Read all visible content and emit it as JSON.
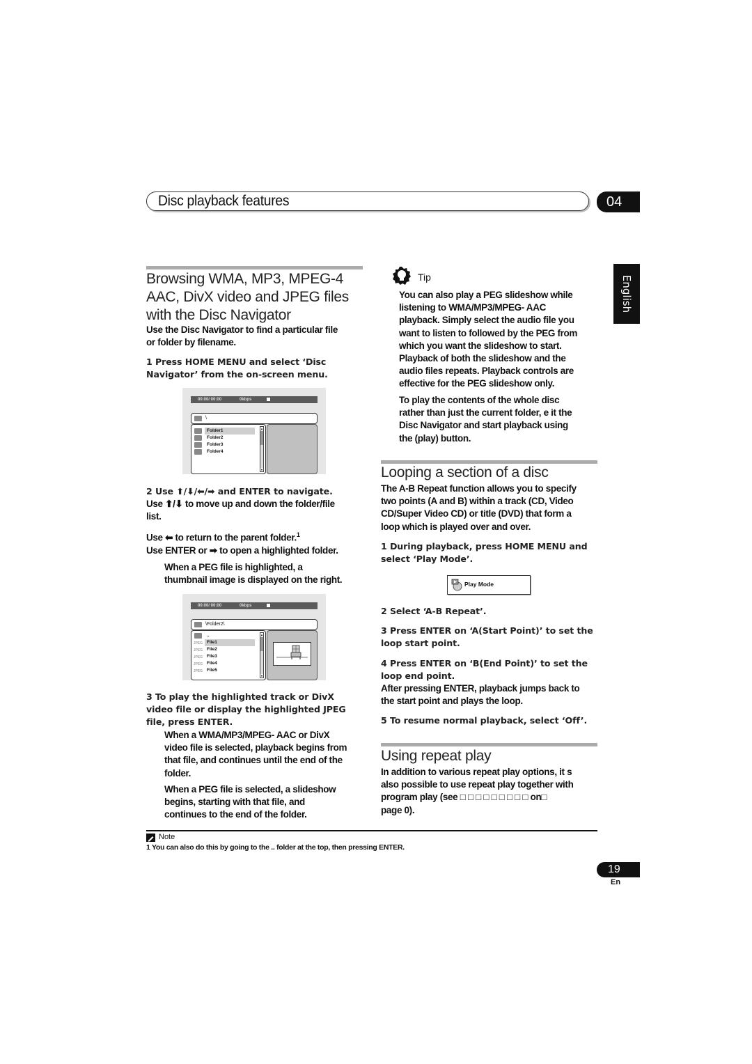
{
  "header": {
    "title": "Disc playback features",
    "chapter": "04"
  },
  "language_tab": "English",
  "left": {
    "section_title_lines": [
      "Browsing WMA, MP3, MPEG-4",
      "AAC, DivX video and JPEG files",
      "with the Disc Navigator"
    ],
    "intro": [
      "Use the Disc Navigator to find a particular file",
      "or folder by filename."
    ],
    "step1": [
      "1    Press HOME MENU and select ‘Disc",
      "Navigator’ from the on-screen menu."
    ],
    "screen1": {
      "status": {
        "time": "00:00/ 00:00",
        "bitrate": "0kbps"
      },
      "path": "\\",
      "items": [
        "Folder1",
        "Folder2",
        "Folder3",
        "Folder4"
      ]
    },
    "step2": [
      "2    Use ⬆/⬇/⬅/➡ and ENTER to navigate."
    ],
    "step2_body": [
      "Use ⬆/⬇ to move up and down the folder/file",
      "list."
    ],
    "para_return": "Use ⬅ to return to the parent folder.",
    "para_return_footnote": "1",
    "para_enter": "Use ENTER or ➡ to open a highlighted folder.",
    "para_jpeg": [
      "When a   PEG file is highlighted, a",
      "thumbnail image is displayed on the right."
    ],
    "screen2": {
      "status": {
        "time": "00:00/ 00:00",
        "bitrate": "0kbps"
      },
      "path": "\\Folder2\\",
      "parent": "..",
      "items": [
        "File1",
        "File2",
        "File3",
        "File4",
        "File5"
      ],
      "file_type_label": "JPEG"
    },
    "step3": [
      "3    To play the highlighted track or DivX",
      "video file or display the highlighted JPEG",
      "file, press ENTER."
    ],
    "step3_body1": [
      "When a WMA/MP3/MPEG-   AAC or DivX",
      "video file is selected, playback begins from",
      "that file, and continues until the end of the",
      "folder."
    ],
    "step3_body2": [
      "When a   PEG file is selected, a slideshow",
      "begins, starting with that file, and",
      "continues to the end of the folder."
    ]
  },
  "right": {
    "tip_label": "Tip",
    "tip1": [
      "You can also play a   PEG slideshow while",
      "listening to WMA/MP3/MPEG-   AAC",
      "playback. Simply select the audio file you",
      "want to listen to followed by the   PEG from",
      "which you want the slideshow to start.",
      "Playback of both the slideshow and the",
      "audio files repeats. Playback controls are",
      "effective for the   PEG slideshow only."
    ],
    "tip2": [
      "To play the contents of the whole disc",
      "rather than just the current folder, e  it the",
      "Disc Navigator and start playback using",
      "the      (play) button."
    ],
    "loop_title": "Looping a section of a disc",
    "loop_intro": [
      "The A-B Repeat function allows you to specify",
      "two points (A and B) within a track (CD, Video",
      "CD/Super Video CD) or title (DVD) that form a",
      "loop which is played over and over."
    ],
    "loop_step1": [
      "1    During playback, press HOME MENU and",
      "select ‘Play Mode’."
    ],
    "play_mode_label": "Play Mode",
    "loop_step2": "2    Select ‘A-B Repeat’.",
    "loop_step3": [
      "3    Press ENTER on ‘A(Start Point)’ to set the",
      "loop start point."
    ],
    "loop_step4": [
      "4    Press ENTER on ‘B(End Point)’ to set the",
      "loop end point."
    ],
    "loop_after": [
      "After pressing ENTER, playback jumps back to",
      "the start point and plays the loop."
    ],
    "loop_step5": "5    To resume normal playback, select ‘Off’.",
    "repeat_title": "Using repeat play",
    "repeat_body": [
      "In addition to various repeat play options, it s",
      "also possible to use repeat play together with",
      "program play (see □ □ □ □ □ □ □ □ □ on□",
      "page   0)."
    ]
  },
  "footer": {
    "note_label": "Note",
    "note_text": "1 You can also do this by going to the  ..  folder at the top, then pressing ENTER.",
    "page_number": "19",
    "page_lang": "En"
  }
}
